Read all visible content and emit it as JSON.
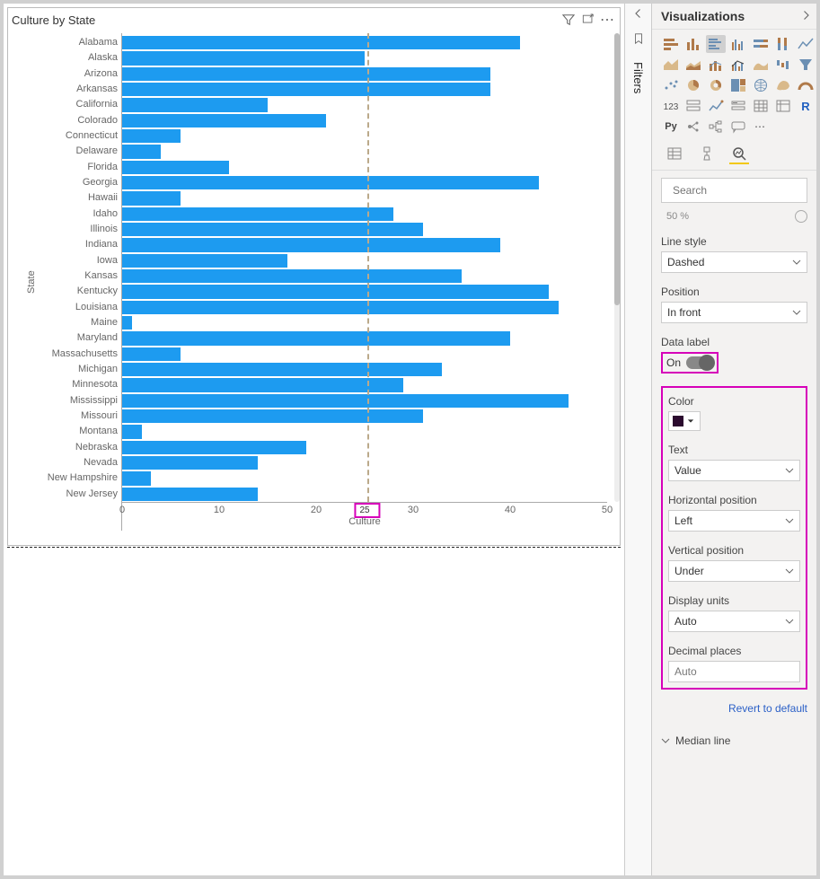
{
  "canvas": {
    "title": "Culture by State",
    "x_axis_label": "Culture",
    "y_axis_label": "State",
    "x_ticks": [
      "0",
      "10",
      "20",
      "30",
      "40",
      "50"
    ],
    "ref_line": {
      "value": 25,
      "label": "25"
    }
  },
  "chart_data": {
    "type": "bar",
    "orientation": "horizontal",
    "title": "Culture by State",
    "xlabel": "Culture",
    "ylabel": "State",
    "xlim": [
      0,
      50
    ],
    "reference_line": {
      "value": 25,
      "style": "dashed",
      "label": "25"
    },
    "categories": [
      "Alabama",
      "Alaska",
      "Arizona",
      "Arkansas",
      "California",
      "Colorado",
      "Connecticut",
      "Delaware",
      "Florida",
      "Georgia",
      "Hawaii",
      "Idaho",
      "Illinois",
      "Indiana",
      "Iowa",
      "Kansas",
      "Kentucky",
      "Louisiana",
      "Maine",
      "Maryland",
      "Massachusetts",
      "Michigan",
      "Minnesota",
      "Mississippi",
      "Missouri",
      "Montana",
      "Nebraska",
      "Nevada",
      "New Hampshire",
      "New Jersey"
    ],
    "values": [
      41,
      25,
      38,
      38,
      15,
      21,
      6,
      4,
      11,
      43,
      6,
      28,
      31,
      39,
      17,
      35,
      44,
      45,
      1,
      40,
      6,
      33,
      29,
      46,
      31,
      2,
      19,
      14,
      3,
      14
    ]
  },
  "filters_label": "Filters",
  "viz_pane": {
    "title": "Visualizations",
    "search_placeholder": "Search",
    "truncated_value": "50  %",
    "line_style": {
      "label": "Line style",
      "value": "Dashed"
    },
    "position": {
      "label": "Position",
      "value": "In front"
    },
    "data_label": {
      "label": "Data label",
      "toggle": "On"
    },
    "color": {
      "label": "Color",
      "value": "#2b0a2e"
    },
    "text": {
      "label": "Text",
      "value": "Value"
    },
    "h_pos": {
      "label": "Horizontal position",
      "value": "Left"
    },
    "v_pos": {
      "label": "Vertical position",
      "value": "Under"
    },
    "display_units": {
      "label": "Display units",
      "value": "Auto"
    },
    "decimal_places": {
      "label": "Decimal places",
      "value": "Auto"
    },
    "revert": "Revert to default",
    "median_section": "Median line",
    "more": "…"
  }
}
